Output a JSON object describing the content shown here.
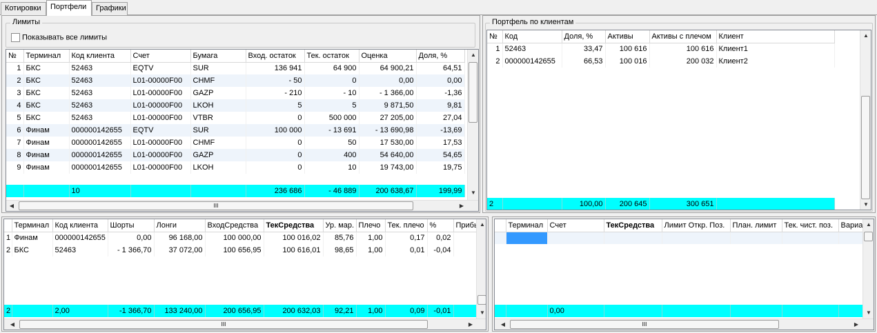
{
  "tabs": [
    "Котировки",
    "Портфели",
    "Графики"
  ],
  "limits": {
    "title": "Лимиты",
    "show_all_label": "Показывать все лимиты",
    "columns": [
      "№",
      "Терминал",
      "Код клиента",
      "Счет",
      "Бумага",
      "Вход. остаток",
      "Тек. остаток",
      "Оценка",
      "Доля, %"
    ],
    "rows": [
      [
        "1",
        "БКС",
        "52463",
        "EQTV",
        "SUR",
        "136 941",
        "64 900",
        "64 900,21",
        "64,51"
      ],
      [
        "2",
        "БКС",
        "52463",
        "L01-00000F00",
        "CHMF",
        "- 50",
        "0",
        "0,00",
        "0,00"
      ],
      [
        "3",
        "БКС",
        "52463",
        "L01-00000F00",
        "GAZP",
        "- 210",
        "- 10",
        "- 1 366,00",
        "-1,36"
      ],
      [
        "4",
        "БКС",
        "52463",
        "L01-00000F00",
        "LKOH",
        "5",
        "5",
        "9 871,50",
        "9,81"
      ],
      [
        "5",
        "БКС",
        "52463",
        "L01-00000F00",
        "VTBR",
        "0",
        "500 000",
        "27 205,00",
        "27,04"
      ],
      [
        "6",
        "Финам",
        "000000142655",
        "EQTV",
        "SUR",
        "100 000",
        "- 13 691",
        "- 13 690,98",
        "-13,69"
      ],
      [
        "7",
        "Финам",
        "000000142655",
        "L01-00000F00",
        "CHMF",
        "0",
        "50",
        "17 530,00",
        "17,53"
      ],
      [
        "8",
        "Финам",
        "000000142655",
        "L01-00000F00",
        "GAZP",
        "0",
        "400",
        "54 640,00",
        "54,65"
      ],
      [
        "9",
        "Финам",
        "000000142655",
        "L01-00000F00",
        "LKOH",
        "0",
        "10",
        "19 743,00",
        "19,75"
      ]
    ],
    "total": [
      "",
      "",
      "10",
      "",
      "",
      "236 686",
      "- 46 889",
      "200 638,67",
      "199,99"
    ]
  },
  "portfolio": {
    "title": "Портфель по клиентам",
    "columns": [
      "№",
      "Код",
      "Доля, %",
      "Активы",
      "Активы с плечом",
      "Клиент"
    ],
    "rows": [
      [
        "1",
        "52463",
        "33,47",
        "100 616",
        "100 616",
        "Клиент1"
      ],
      [
        "2",
        "000000142655",
        "66,53",
        "100 016",
        "200 032",
        "Клиент2"
      ]
    ],
    "total": [
      "2",
      "",
      "100,00",
      "200 645",
      "300 651",
      ""
    ]
  },
  "clients": {
    "columns": [
      "Терминал",
      "Код клиента",
      "Шорты",
      "Лонги",
      "ВходСредства",
      "ТекСредства",
      "Ур. мар.",
      "Плечо",
      "Тек. плечо",
      "%",
      "Прибы"
    ],
    "rows": [
      [
        "1",
        "Финам",
        "000000142655",
        "0,00",
        "96 168,00",
        "100 000,00",
        "100 016,02",
        "85,76",
        "1,00",
        "0,17",
        "0,02",
        ""
      ],
      [
        "2",
        "БКС",
        "52463",
        "- 1 366,70",
        "37 072,00",
        "100 656,95",
        "100 616,01",
        "98,65",
        "1,00",
        "0,01",
        "-0,04",
        ""
      ]
    ],
    "total": [
      "2",
      "",
      "2,00",
      "-1 366,70",
      "133 240,00",
      "200 656,95",
      "200 632,03",
      "92,21",
      "1,00",
      "0,09",
      "-0,01",
      ""
    ]
  },
  "positions": {
    "columns": [
      "Терминал",
      "Счет",
      "ТекСредства",
      "Лимит Откр. Поз.",
      "План. лимит",
      "Тек. чист. поз.",
      "Вариа"
    ],
    "total": [
      "",
      "",
      "0,00",
      "",
      "",
      "",
      "",
      ""
    ]
  },
  "scroll_glyph": "III",
  "accent": "#00ffff"
}
